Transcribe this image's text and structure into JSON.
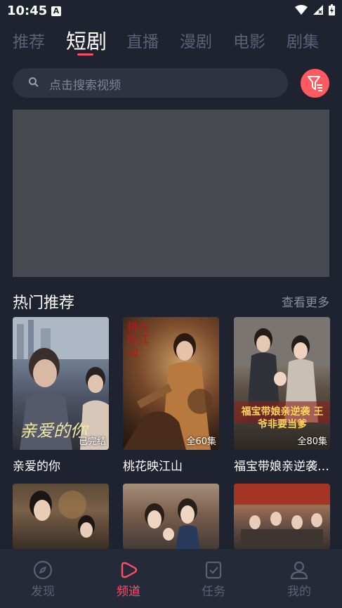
{
  "status_bar": {
    "time": "10:45",
    "notification_icon": "A"
  },
  "tabs": [
    {
      "label": "推荐",
      "active": false
    },
    {
      "label": "短剧",
      "active": true
    },
    {
      "label": "直播",
      "active": false
    },
    {
      "label": "漫剧",
      "active": false
    },
    {
      "label": "电影",
      "active": false
    },
    {
      "label": "剧集",
      "active": false
    }
  ],
  "search": {
    "placeholder": "点击搜索视频",
    "icon": "search-icon"
  },
  "filter_button": {
    "icon": "filter-icon",
    "color": "#ff5a5f"
  },
  "section": {
    "title": "热门推荐",
    "more": "查看更多"
  },
  "cards": [
    {
      "title": "亲爱的你",
      "badge": "已完结",
      "poster_text": "亲爱的你"
    },
    {
      "title": "桃花映江山",
      "badge": "全60集",
      "poster_text": "桃花映江山"
    },
    {
      "title": "福宝带娘亲逆袭，王爷非要当爹",
      "badge": "全80集",
      "poster_text": "福宝带娘亲逆袭 王爷非要当爹"
    },
    {
      "title": "",
      "badge": ""
    },
    {
      "title": "",
      "badge": ""
    },
    {
      "title": "",
      "badge": ""
    }
  ],
  "bottom_nav": [
    {
      "label": "发现",
      "icon": "compass-icon",
      "active": false
    },
    {
      "label": "频道",
      "icon": "play-icon",
      "active": true
    },
    {
      "label": "任务",
      "icon": "task-icon",
      "active": false
    },
    {
      "label": "我的",
      "icon": "profile-icon",
      "active": false
    }
  ],
  "colors": {
    "accent": "#ff4d6a",
    "background": "#1f2330",
    "inactive": "#5b6173"
  }
}
